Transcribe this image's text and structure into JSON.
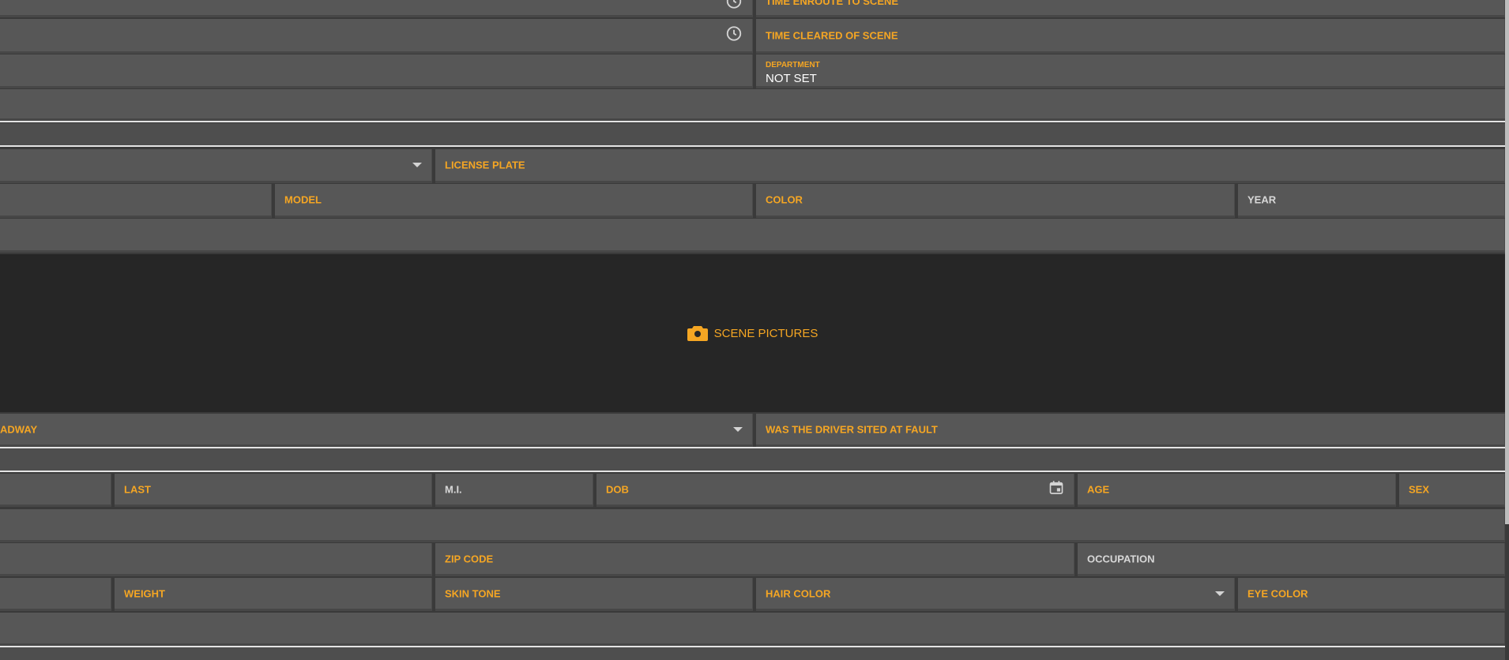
{
  "incident_times": {
    "enroute_label": "TIME ENROUTE TO SCENE",
    "cleared_label": "TIME CLEARED OF SCENE"
  },
  "department": {
    "label": "DEPARTMENT",
    "value": "NOT SET"
  },
  "vehicle": {
    "license_plate_label": "LICENSE PLATE",
    "model_label": "MODEL",
    "color_label": "COLOR",
    "year_label": "YEAR"
  },
  "scene_pictures": {
    "label": "SCENE PICTURES",
    "icon": "camera-icon"
  },
  "roadway": {
    "label_partial": "ADWAY",
    "driver_fault_label": "WAS THE DRIVER SITED AT FAULT"
  },
  "person": {
    "last_label": "LAST",
    "mi_label": "M.I.",
    "dob_label": "DOB",
    "age_label": "AGE",
    "sex_label": "SEX",
    "zip_label": "ZIP CODE",
    "occupation_label": "OCCUPATION",
    "weight_label": "WEIGHT",
    "skin_tone_label": "SKIN TONE",
    "hair_color_label": "HAIR COLOR",
    "eye_color_label": "EYE COLOR"
  },
  "colors": {
    "accent": "#f5a623",
    "field_bg": "#575757",
    "panel_dark": "#262626"
  }
}
